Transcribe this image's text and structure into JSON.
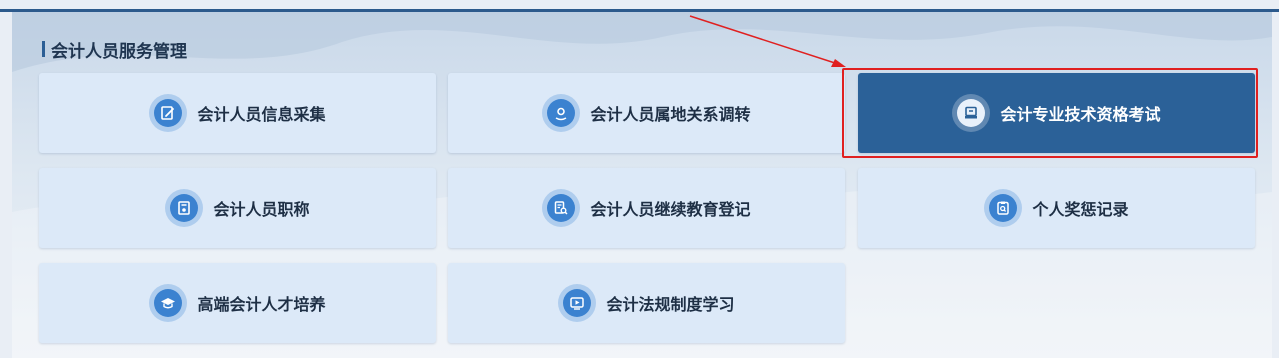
{
  "section": {
    "title": "会计人员服务管理"
  },
  "cards": [
    {
      "label": "会计人员信息采集",
      "icon": "edit-document-icon"
    },
    {
      "label": "会计人员属地关系调转",
      "icon": "location-pin-icon"
    },
    {
      "label": "会计专业技术资格考试",
      "icon": "exam-paper-icon"
    },
    {
      "label": "会计人员职称",
      "icon": "certificate-icon"
    },
    {
      "label": "会计人员继续教育登记",
      "icon": "document-search-icon"
    },
    {
      "label": "个人奖惩记录",
      "icon": "clipboard-search-icon"
    },
    {
      "label": "高端会计人才培养",
      "icon": "graduation-cap-icon"
    },
    {
      "label": "会计法规制度学习",
      "icon": "video-play-icon"
    }
  ],
  "colors": {
    "accent": "#2b6198",
    "icon": "#3b82d0",
    "highlight": "#e02020"
  }
}
